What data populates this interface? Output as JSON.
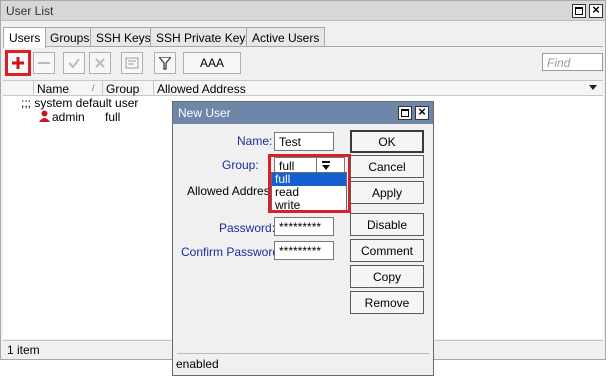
{
  "window": {
    "title": "User List"
  },
  "tabs": [
    "Users",
    "Groups",
    "SSH Keys",
    "SSH Private Keys",
    "Active Users"
  ],
  "toolbar": {
    "aaa_label": "AAA",
    "find_placeholder": "Find"
  },
  "table": {
    "columns": [
      "Name",
      "Group",
      "Allowed Address"
    ],
    "comment_row": ";;; system default user",
    "rows": [
      {
        "name": "admin",
        "group": "full",
        "allowed_address": ""
      }
    ]
  },
  "status": {
    "count": "1 item"
  },
  "dialog": {
    "title": "New User",
    "labels": {
      "name": "Name:",
      "group": "Group:",
      "allowed_address": "Allowed Address:",
      "password": "Password:",
      "confirm_password": "Confirm Password:"
    },
    "values": {
      "name": "Test",
      "group": "full",
      "password": "*********",
      "confirm_password": "*********"
    },
    "group_options": [
      "full",
      "read",
      "write"
    ],
    "buttons": [
      "OK",
      "Cancel",
      "Apply",
      "Disable",
      "Comment",
      "Copy",
      "Remove"
    ],
    "status": "enabled"
  },
  "colors": {
    "highlight": "#d9202a",
    "dialog_title": "#6e86a8",
    "selected_option": "#1460d0",
    "label_blue": "#1a2e9e"
  }
}
